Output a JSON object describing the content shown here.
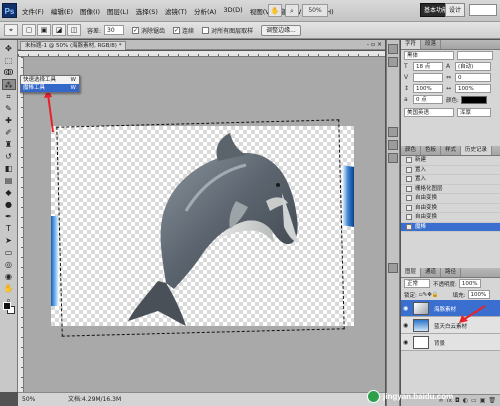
{
  "app": {
    "logo": "Ps"
  },
  "menu": [
    "文件(F)",
    "编辑(E)",
    "图像(I)",
    "图层(L)",
    "选择(S)",
    "滤镜(T)",
    "分析(A)",
    "3D(D)",
    "视图(V)",
    "窗口(W)",
    "帮助(H)"
  ],
  "menubar_tools": {
    "zoom": "50%"
  },
  "workspace": {
    "essentials": "基本功能",
    "design": "设计",
    "more": "»"
  },
  "options": {
    "tolerance_label": "容差:",
    "tolerance_value": "30",
    "antialias_label": "消除锯齿",
    "contiguous_label": "连续",
    "sample_all_label": "对所有图层取样",
    "refine_edge_label": "调整边缘..."
  },
  "flyout": [
    {
      "label": "快速选择工具",
      "shortcut": "W"
    },
    {
      "label": "魔棒工具",
      "shortcut": "W"
    }
  ],
  "document": {
    "tab_title": "未标题-1 @ 50% (海豚素材, RGB/8) *",
    "controls": "- ▫ ×"
  },
  "status": {
    "zoom": "50%",
    "doc_info": "文档:4.29M/16.3M"
  },
  "character_panel": {
    "tabs": [
      "字符",
      "段落"
    ],
    "font_family": "黑体",
    "font_size": "18 点",
    "leading": "(自动)",
    "tracking": "0",
    "vscale": "100%",
    "hscale": "100%",
    "baseline": "0 点",
    "color_label": "颜色:",
    "language": "美国英语",
    "antialias": "浑厚"
  },
  "history_panel": {
    "tabs": [
      "颜色",
      "色板",
      "样式",
      "历史记录"
    ],
    "items": [
      "新建",
      "置入",
      "置入",
      "栅格化图层",
      "自由变换",
      "自由变换",
      "自由变换",
      "魔棒"
    ]
  },
  "layers_panel": {
    "tabs": [
      "图层",
      "通道",
      "路径"
    ],
    "blend_mode": "正常",
    "opacity_label": "不透明度:",
    "opacity": "100%",
    "lock_label": "锁定:",
    "fill_label": "填充:",
    "fill": "100%",
    "layers": [
      {
        "name": "海豚素材",
        "selected": true
      },
      {
        "name": "蓝天白云素材",
        "selected": false
      },
      {
        "name": "背景",
        "selected": false
      }
    ]
  },
  "watermark": "jingyan.baidu.com",
  "colors": {
    "selection_blue": "#3a6fcf",
    "accent_red": "#e8222a"
  }
}
